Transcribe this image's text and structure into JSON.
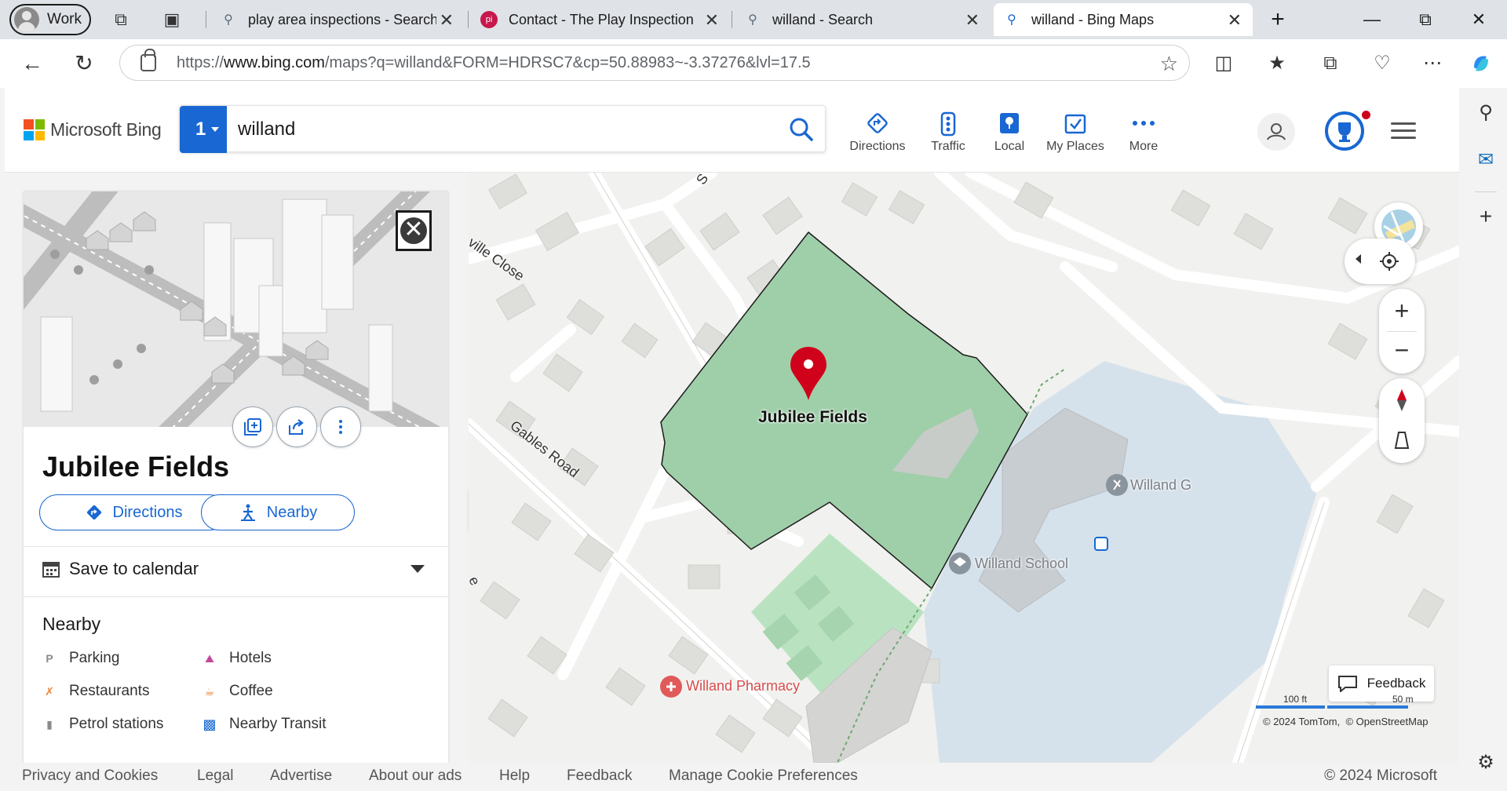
{
  "browser": {
    "profile_label": "Work",
    "tabs": [
      {
        "title": "play area inspections - Search",
        "icon": "search-icon"
      },
      {
        "title": "Contact - The Play Inspection C",
        "icon": "pi-favicon",
        "icon_text": "pi"
      },
      {
        "title": "willand - Search",
        "icon": "search-icon"
      },
      {
        "title": "willand - Bing Maps",
        "icon": "search-icon",
        "active": true
      }
    ],
    "url_prefix": "https://",
    "url_host": "www.bing.com",
    "url_path": "/maps?q=willand&FORM=HDRSC7&cp=50.88983~-3.37276&lvl=17.5"
  },
  "bing": {
    "brand": "Microsoft Bing",
    "search_count": "1",
    "search_query": "willand",
    "nav": [
      {
        "label": "Directions",
        "icon": "directions-icon"
      },
      {
        "label": "Traffic",
        "icon": "traffic-icon"
      },
      {
        "label": "Local",
        "icon": "local-icon"
      },
      {
        "label": "My Places",
        "icon": "my-places-icon"
      },
      {
        "label": "More",
        "icon": "more-dots-icon"
      }
    ]
  },
  "place": {
    "name": "Jubilee Fields",
    "directions_label": "Directions",
    "nearby_label": "Nearby",
    "save_calendar_label": "Save to calendar",
    "nearby_heading": "Nearby",
    "nearby_items": [
      {
        "label": "Parking",
        "icon": "parking-icon",
        "color": "#8a8a8a"
      },
      {
        "label": "Hotels",
        "icon": "hotel-icon",
        "color": "#c2489a"
      },
      {
        "label": "Restaurants",
        "icon": "restaurant-icon",
        "color": "#e8833a"
      },
      {
        "label": "Coffee",
        "icon": "coffee-icon",
        "color": "#e8833a"
      },
      {
        "label": "Petrol stations",
        "icon": "petrol-icon",
        "color": "#8a8a8a"
      },
      {
        "label": "Nearby Transit",
        "icon": "transit-icon",
        "color": "#1967d2"
      }
    ]
  },
  "map": {
    "labels": {
      "close": "ville Close",
      "gables": "Gables Road",
      "top_road": "S",
      "left_road": "e",
      "jubilee": "Jubilee Fields",
      "willand_g": "Willand G",
      "school": "Willand School",
      "pharmacy": "Willand Pharmacy"
    },
    "feedback_label": "Feedback",
    "scale_ft": "100 ft",
    "scale_m": "50 m",
    "attribution_1": "© 2024 TomTom,",
    "attribution_2": "© OpenStreetMap",
    "colors": {
      "park": "#9fcfa9",
      "sports": "#b9e3c0",
      "school": "#d7e3ec",
      "building": "#dcdcd8",
      "pin": "#d0021b"
    }
  },
  "footer": {
    "links": [
      "Privacy and Cookies",
      "Legal",
      "Advertise",
      "About our ads",
      "Help",
      "Feedback",
      "Manage Cookie Preferences"
    ],
    "copyright": "© 2024 Microsoft"
  }
}
